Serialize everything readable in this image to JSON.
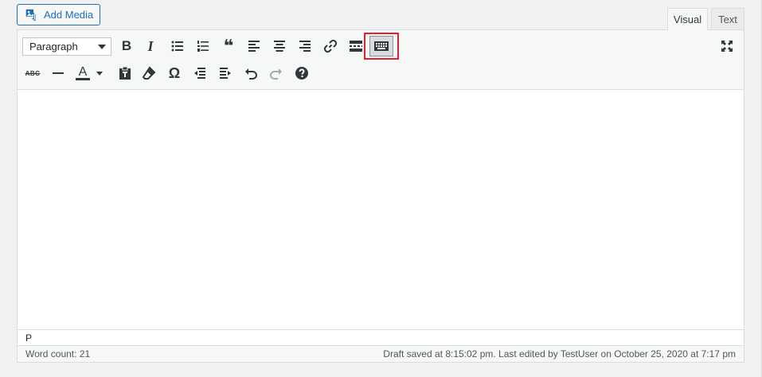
{
  "header": {
    "add_media_label": "Add Media",
    "tabs": [
      {
        "label": "Visual",
        "active": true
      },
      {
        "label": "Text",
        "active": false
      }
    ]
  },
  "toolbar": {
    "format_select": {
      "selected": "Paragraph"
    },
    "row1_icons": [
      "bold-icon",
      "italic-icon",
      "bulleted-list-icon",
      "numbered-list-icon",
      "blockquote-icon",
      "align-left-icon",
      "align-center-icon",
      "align-right-icon",
      "link-icon",
      "read-more-icon",
      "toolbar-toggle-icon"
    ],
    "row2_icons": [
      "strikethrough-icon",
      "horizontal-line-icon",
      "text-color-icon",
      "paste-as-text-icon",
      "clear-formatting-icon",
      "special-character-icon",
      "outdent-icon",
      "indent-icon",
      "undo-icon",
      "redo-icon",
      "help-icon"
    ],
    "fullscreen_icon": "fullscreen-icon",
    "bold_glyph": "B",
    "italic_glyph": "I",
    "strike_glyph": "ABC",
    "text_color_glyph": "A",
    "special_char_glyph": "Ω",
    "quote_glyph": "❝"
  },
  "editor": {
    "path": "P"
  },
  "status": {
    "word_count": "Word count: 21",
    "draft_info": "Draft saved at 8:15:02 pm. Last edited by TestUser on October 25, 2020 at 7:17 pm"
  },
  "colors": {
    "accent": "#2271b1",
    "highlight_border": "#e3202b",
    "toolbar_bg": "#f6f7f7"
  }
}
